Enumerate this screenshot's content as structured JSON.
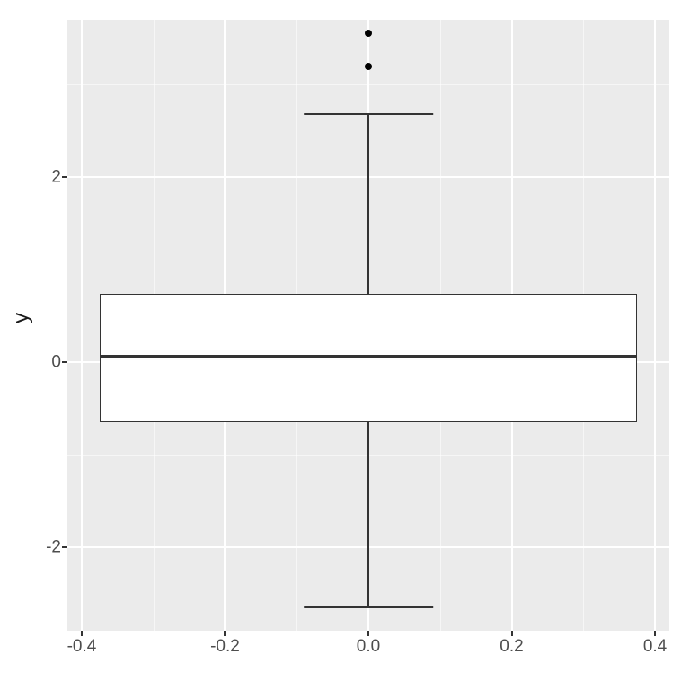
{
  "chart_data": {
    "type": "boxplot",
    "ylabel": "y",
    "xlabel": "",
    "x_ticks": [
      -0.4,
      -0.2,
      0.0,
      0.2,
      0.4
    ],
    "y_ticks": [
      -2,
      0,
      2
    ],
    "xlim": [
      -0.42,
      0.42
    ],
    "ylim": [
      -2.9,
      3.7
    ],
    "box": {
      "x_left": -0.375,
      "x_right": 0.375,
      "q1": -0.65,
      "median": 0.07,
      "q3": 0.74,
      "whisker_low": -2.65,
      "whisker_high": 2.68,
      "whisker_cap_half_width": 0.09,
      "outliers": [
        3.2,
        3.55
      ]
    },
    "style": {
      "panel_bg": "#EBEBEB",
      "grid_color": "#FFFFFF",
      "line_color": "#333333"
    }
  },
  "labels": {
    "y_title": "y",
    "x_ticks": {
      "0": "-0.4",
      "1": "-0.2",
      "2": "0.0",
      "3": "0.2",
      "4": "0.4"
    },
    "y_ticks": {
      "0": "-2",
      "1": "0",
      "2": "2"
    }
  }
}
